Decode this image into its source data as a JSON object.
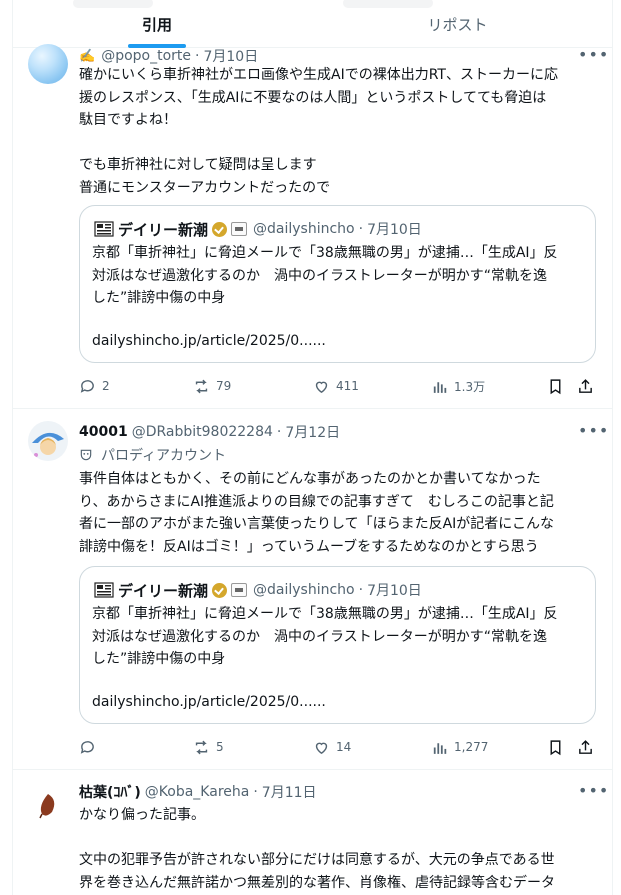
{
  "tabs": [
    {
      "label": "引用",
      "active": true
    },
    {
      "label": "リポスト",
      "active": false
    }
  ],
  "posts": [
    {
      "prefix": "✍️",
      "name": "",
      "handle": "@popo_torte",
      "date": "7月10日",
      "text": "確かにいくら車折神社がエロ画像や生成AIでの裸体出力RT、ストーカーに応\n援のレスポンス、「生成AIに不要なのは人間」というポストしてても脅迫は\n駄目ですよね！\n\nでも車折神社に対して疑問は呈します\n普通にモンスターアカウントだったので",
      "quote": {
        "name": "デイリー新潮",
        "handle": "@dailyshincho",
        "date": "7月10日",
        "text": "京都「車折神社」に脅迫メールで「38歳無職の男」が逮捕…「生成AI」反\n対派はなぜ過激化するのか　渦中のイラストレーターが明かす“常軌を逸\nした”誹謗中傷の中身",
        "link": "dailyshincho.jp/article/2025/0......"
      },
      "replies": "2",
      "reposts": "79",
      "likes": "411",
      "views": "1.3万"
    },
    {
      "prefix": "",
      "name": "40001",
      "handle": "@DRabbit98022284",
      "date": "7月12日",
      "sublabel": "パロディアカウント",
      "text": "事件自体はともかく、その前にどんな事があったのかとか書いてなかった\nり、あからさまにAI推進派よりの目線での記事すぎて　むしろこの記事と記\n者に一部のアホがまた強い言葉使ったりして「ほらまた反AIが記者にこんな\n誹謗中傷を！反AIはゴミ！」っていうムーブをするためなのかとすら思う",
      "quote": {
        "name": "デイリー新潮",
        "handle": "@dailyshincho",
        "date": "7月10日",
        "text": "京都「車折神社」に脅迫メールで「38歳無職の男」が逮捕…「生成AI」反\n対派はなぜ過激化するのか　渦中のイラストレーターが明かす“常軌を逸\nした”誹謗中傷の中身",
        "link": "dailyshincho.jp/article/2025/0......"
      },
      "replies": "",
      "reposts": "5",
      "likes": "14",
      "views": "1,277"
    },
    {
      "prefix": "",
      "name": "枯葉(ｺﾊﾞ)",
      "handle": "@Koba_Kareha",
      "date": "7月11日",
      "text": "かなり偏った記事。\n\n文中の犯罪予告が許されない部分にだけは同意するが、大元の争点である世\n界を巻き込んだ無許諾かつ無差別的な著作、肖像権、虐待記録等含むデータ"
    }
  ],
  "colors": {
    "accent": "#1d9bf0",
    "text": "#0f1419",
    "muted": "#536471",
    "border": "#cfd9de",
    "verified": "#d4a72c"
  }
}
